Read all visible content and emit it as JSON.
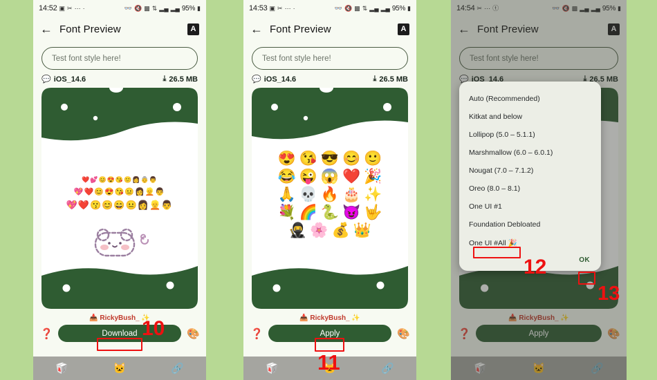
{
  "app": {
    "title": "Font Preview",
    "back_icon": "back-arrow-icon",
    "font_badge": "A"
  },
  "panels": [
    {
      "id": "panel-download",
      "status": {
        "time": "14:52",
        "left_icons": [
          "screenshot-icon",
          "mute-icon",
          "dots-icon",
          "dot-icon"
        ],
        "right_icons": [
          "link-icon",
          "silent-icon",
          "nfc-icon",
          "vpn-icon",
          "signal-icon",
          "signal2-icon"
        ],
        "battery": "95%"
      },
      "test_field_placeholder": "Test font style here!",
      "font_name": "iOS_14.6",
      "font_size": "26.5 MB",
      "preview": {
        "emoji_row_1": "❤️💕😊😍😘🙂👩👵👨",
        "emoji_row_2": "💖❤️😊😍😘😐👩👱👨",
        "emoji_row_3": "💖❤️😗😊😄😐👩👱👨",
        "mascot": "🐻"
      },
      "credit": "RickyBush_ ✨",
      "help_icon": "question-mark-icon",
      "palette_icon": "palette-icon",
      "main_button": "Download",
      "nav_icons": [
        "box-icon",
        "cat-icon",
        "chain-icon"
      ]
    },
    {
      "id": "panel-apply",
      "status": {
        "time": "14:53",
        "battery": "95%"
      },
      "test_field_placeholder": "Test font style here!",
      "font_name": "iOS_14.6",
      "font_size": "26.5 MB",
      "preview": {
        "emoji_grid": [
          [
            "😍",
            "😘",
            "😎",
            "😊",
            "🙂"
          ],
          [
            "😂",
            "😜",
            "😱",
            "❤️",
            "🎉"
          ],
          [
            "🙏",
            "💀",
            "🔥",
            "🎂",
            "✨"
          ],
          [
            "💐",
            "🌈",
            "🐍",
            "😈",
            "🤟"
          ],
          [
            "🥷",
            "🌸",
            "💰",
            "👑"
          ]
        ]
      },
      "credit": "RickyBush_ ✨",
      "main_button": "Apply",
      "nav_icons": [
        "box-icon",
        "cat-icon",
        "chain-icon"
      ]
    },
    {
      "id": "panel-dialog",
      "status": {
        "time": "14:54",
        "battery": "95%"
      },
      "test_field_placeholder": "Test font style here!",
      "font_name": "iOS_14.6",
      "font_size": "26.5 MB",
      "credit": "RickyBush_ ✨",
      "main_button": "Apply",
      "nav_icons": [
        "box-icon",
        "cat-icon",
        "chain-icon"
      ],
      "dialog": {
        "options": [
          "Auto (Recommended)",
          "Kitkat and below",
          "Lollipop (5.0 – 5.1.1)",
          "Marshmallow (6.0 – 6.0.1)",
          "Nougat (7.0 – 7.1.2)",
          "Oreo (8.0 – 8.1)",
          "One UI #1",
          "Foundation Debloated",
          "One UI #All 🎉"
        ],
        "selected": "One UI #All 🎉",
        "ok_label": "OK"
      }
    }
  ],
  "annotations": {
    "step_10": "10",
    "step_11": "11",
    "step_12": "12",
    "step_13": "13"
  },
  "colors": {
    "background_green": "#b7d994",
    "phone_bg": "#f7faf2",
    "button_green": "#2f5c32",
    "annotation_red": "#ee1111",
    "nav_gray": "#a5a5a0"
  }
}
